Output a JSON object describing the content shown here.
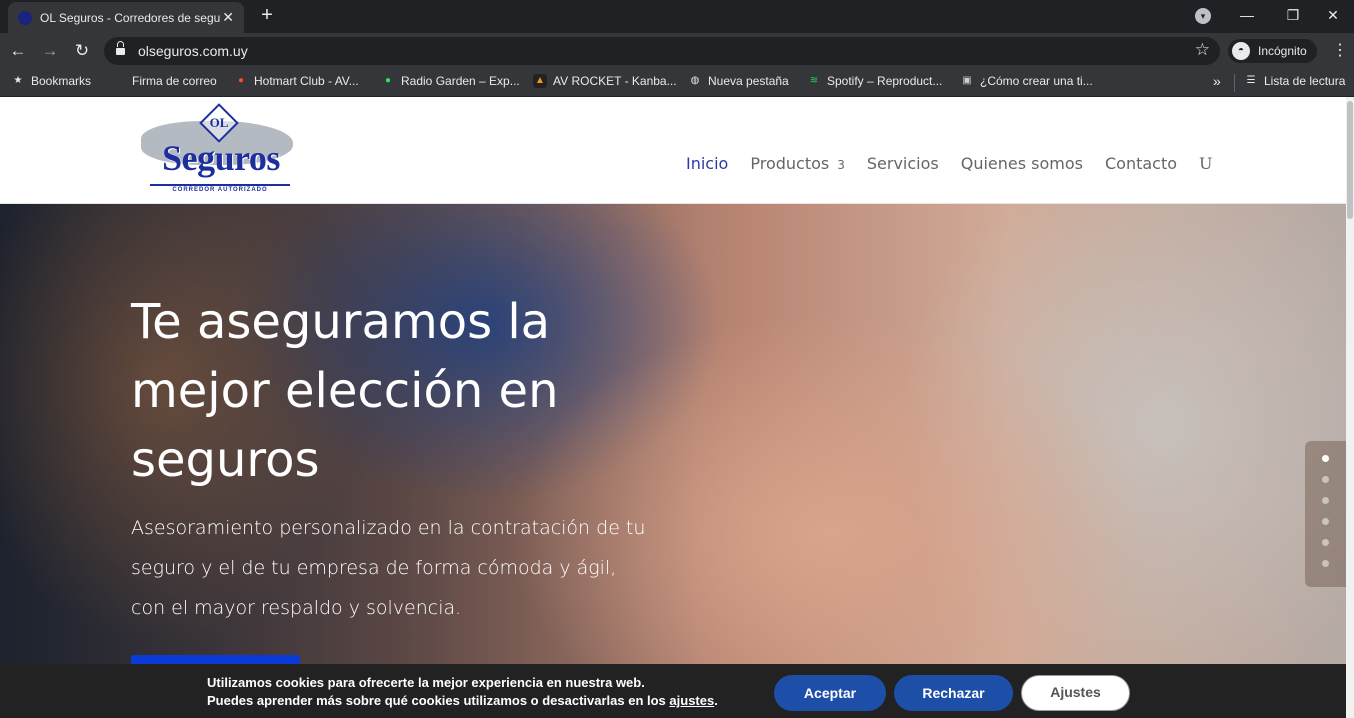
{
  "browser": {
    "tab_title": "OL Seguros - Corredores de segu",
    "tab_close": "✕",
    "new_tab": "+",
    "url": "olseguros.com.uy",
    "incognito_label": "Incógnito",
    "window_controls": {
      "minimize": "—",
      "maximize": "❐",
      "close": "✕"
    },
    "nav": {
      "back": "←",
      "forward": "→",
      "reload": "↻",
      "star": "☆",
      "menu": "⋮"
    },
    "bookmarks": [
      {
        "label": "Bookmarks",
        "icon": "star-icon",
        "glyph": "★",
        "color": "#e8eaed"
      },
      {
        "label": "Firma de correo",
        "icon": "mail-icon",
        "glyph": "",
        "color": "#35363a"
      },
      {
        "label": "Hotmart Club - AV...",
        "icon": "flame-icon",
        "glyph": "●",
        "color": "#f04e23"
      },
      {
        "label": "Radio Garden – Exp...",
        "icon": "radio-dot-icon",
        "glyph": "●",
        "color": "#2ee06a"
      },
      {
        "label": "AV ROCKET - Kanba...",
        "icon": "rocket-icon",
        "glyph": "▲",
        "color": "#f29b1f"
      },
      {
        "label": "Nueva pestaña",
        "icon": "globe-icon",
        "glyph": "◍",
        "color": "#e8eaed"
      },
      {
        "label": "Spotify – Reproduct...",
        "icon": "spotify-icon",
        "glyph": "≋",
        "color": "#1ed760"
      },
      {
        "label": "¿Cómo crear una ti...",
        "icon": "shop-icon",
        "glyph": "▣",
        "color": "#cfcfcf"
      }
    ],
    "more_bookmarks": "»",
    "reading_list": "Lista de lectura"
  },
  "site": {
    "logo": {
      "top": "OL",
      "name": "Seguros",
      "tagline": "CORREDOR AUTORIZADO"
    },
    "menu": {
      "inicio": "Inicio",
      "productos": "Productos",
      "productos_caret": "3",
      "servicios": "Servicios",
      "quienes": "Quienes somos",
      "contacto": "Contacto",
      "search_glyph": "U"
    },
    "hero": {
      "title": "Te aseguramos la mejor elección en seguros",
      "subtitle": "Asesoramiento personalizado en la contratación de tu seguro y el de tu empresa de forma cómoda y ágil, con el mayor respaldo y solvencia.",
      "slides": 6,
      "active_slide": 1
    },
    "cookie": {
      "line1": "Utilizamos cookies para ofrecerte la mejor experiencia en nuestra web.",
      "line2_prefix": "Puedes aprender más sobre qué cookies utilizamos o desactivarlas en los ",
      "line2_link": "ajustes",
      "line2_suffix": ".",
      "accept": "Aceptar",
      "reject": "Rechazar",
      "settings": "Ajustes"
    }
  }
}
